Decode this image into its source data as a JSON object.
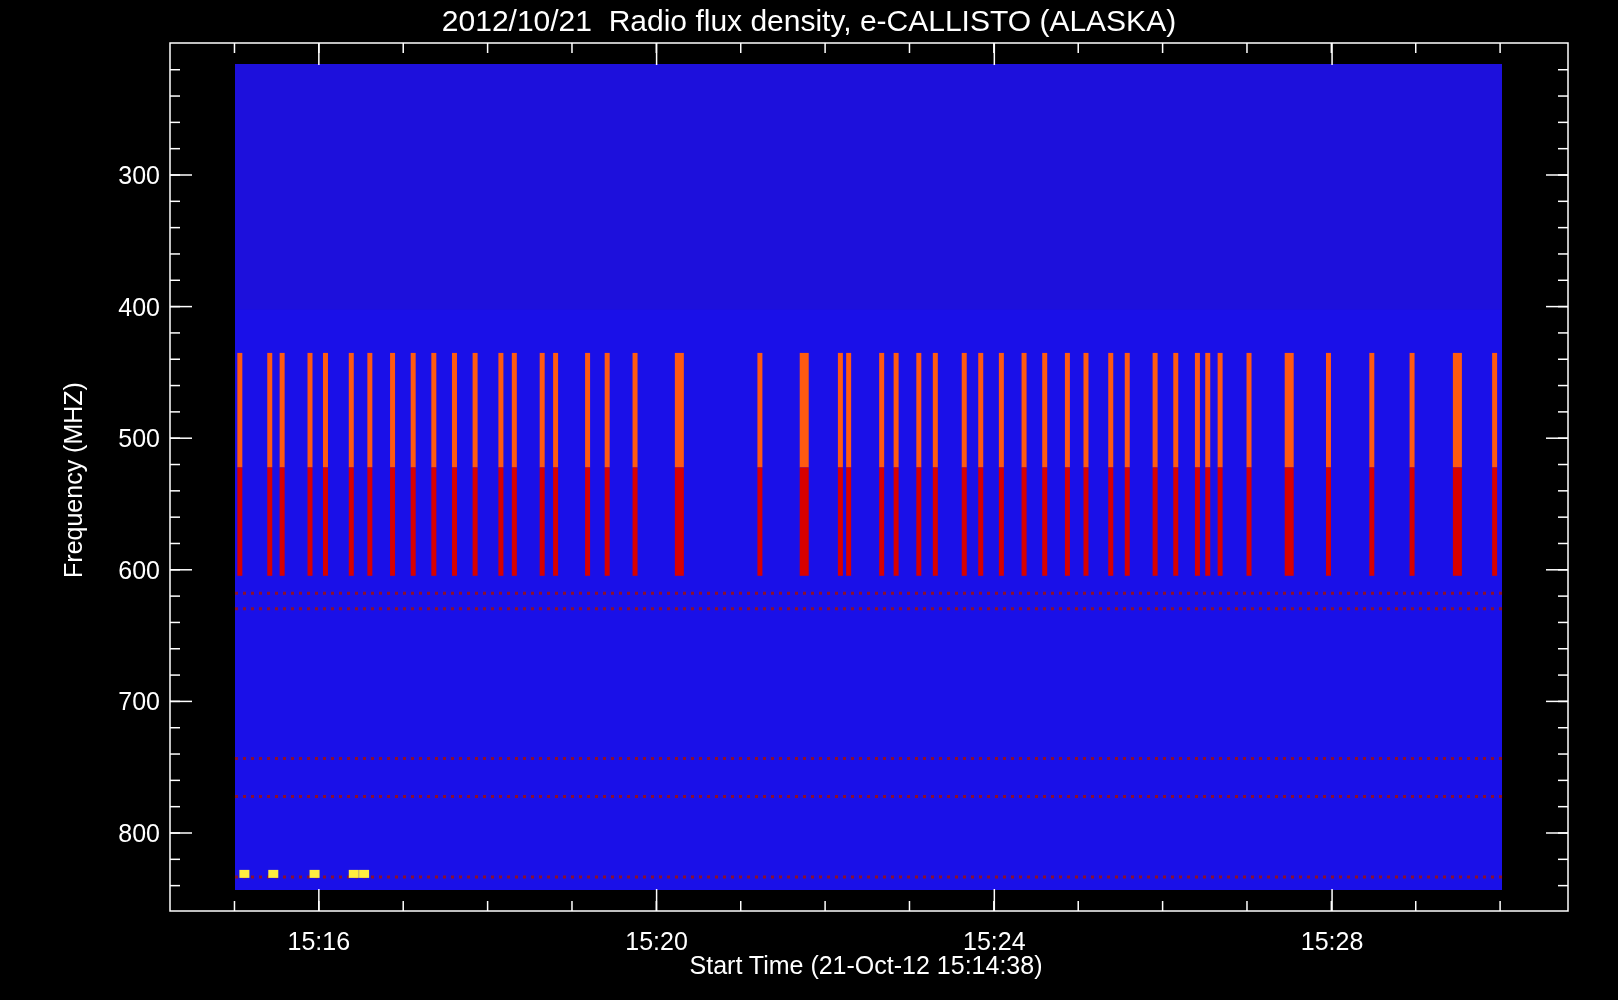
{
  "chart": {
    "title": "2012/10/21  Radio flux density, e-CALLISTO (ALASKA)",
    "xlabel": "Start Time (21-Oct-12 15:14:38)",
    "ylabel": "Frequency (MHZ)",
    "xticks": [
      "15:16",
      "15:20",
      "15:24",
      "15:28"
    ],
    "yticks": [
      "300",
      "400",
      "500",
      "600",
      "700",
      "800"
    ]
  }
}
